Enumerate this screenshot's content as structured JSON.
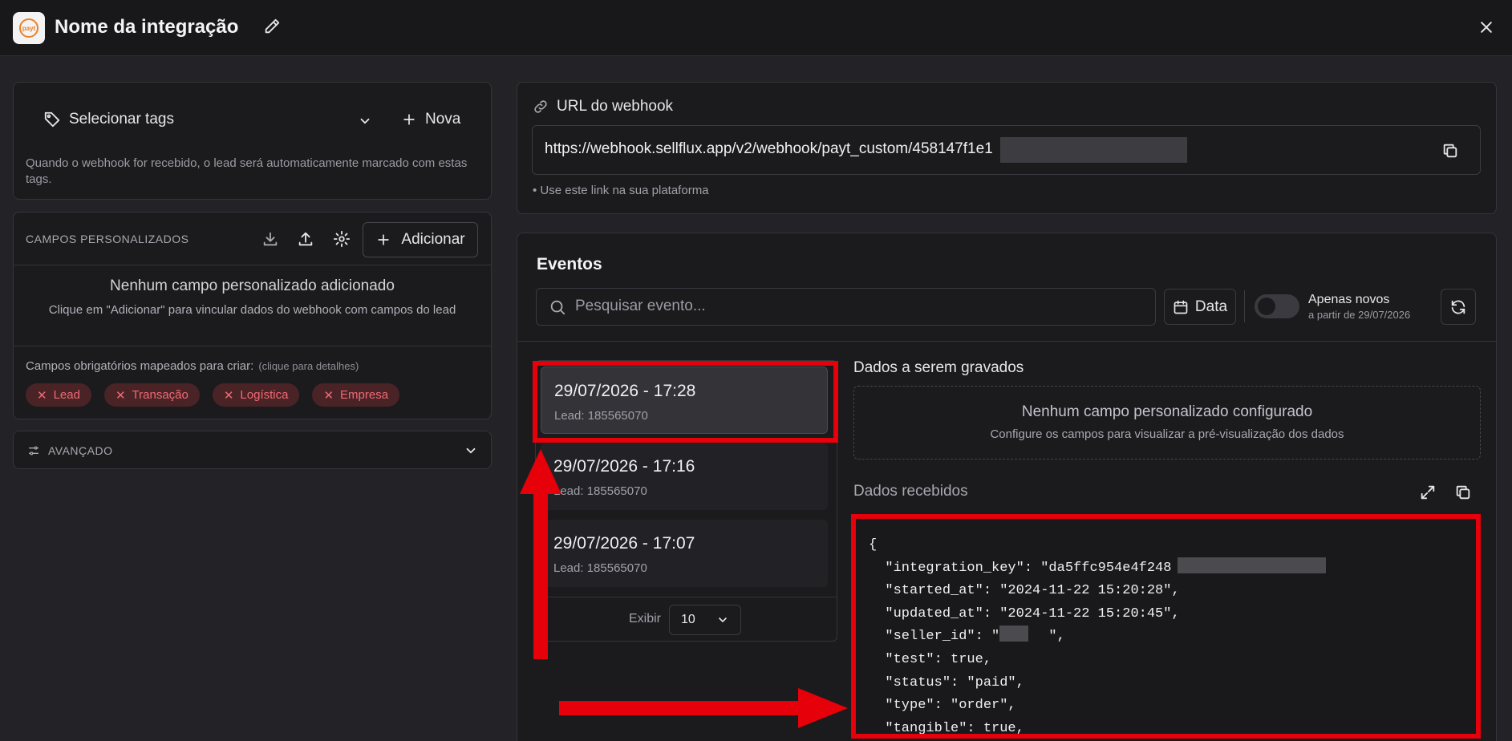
{
  "header": {
    "title": "Nome da integração",
    "logo_text": "payt"
  },
  "tags": {
    "select_label": "Selecionar tags",
    "new_label": "Nova",
    "help": "Quando o webhook for recebido, o lead será automaticamente marcado com estas tags."
  },
  "campos": {
    "title": "CAMPOS PERSONALIZADOS",
    "add_label": "Adicionar",
    "empty_title": "Nenhum campo personalizado adicionado",
    "empty_sub": "Clique em \"Adicionar\" para vincular dados do webhook com campos do lead",
    "required_label": "Campos obrigatórios mapeados para criar:",
    "required_hint": "(clique para detalhes)",
    "chips": [
      "Lead",
      "Transação",
      "Logística",
      "Empresa"
    ]
  },
  "advanced": {
    "label": "AVANÇADO"
  },
  "webhook": {
    "label": "URL do webhook",
    "url": "https://webhook.sellflux.app/v2/webhook/payt_custom/458147f1e1",
    "hint": "• Use este link na sua plataforma"
  },
  "events": {
    "title": "Eventos",
    "search_placeholder": "Pesquisar evento...",
    "date_label": "Data",
    "toggle_title": "Apenas novos",
    "toggle_sub": "a partir de 29/07/2026",
    "toggle_on": false,
    "items": [
      {
        "date": "29/07/2026 - 17:28",
        "lead": "Lead: 185565070"
      },
      {
        "date": "29/07/2026 - 17:16",
        "lead": "Lead: 185565070"
      },
      {
        "date": "29/07/2026 - 17:07",
        "lead": "Lead: 185565070"
      }
    ],
    "show_label": "Exibir",
    "show_value": "10"
  },
  "data_panel": {
    "title": "Dados a serem gravados",
    "empty_title": "Nenhum campo personalizado configurado",
    "empty_sub": "Configure os campos para visualizar a pré-visualização dos dados",
    "received_label": "Dados recebidos",
    "json_lines": [
      "{",
      "  \"integration_key\": \"da5ffc954e4f248                \",",
      "  \"started_at\": \"2024-11-22 15:20:28\",",
      "  \"updated_at\": \"2024-11-22 15:20:45\",",
      "  \"seller_id\": \"R6    \",",
      "  \"test\": true,",
      "  \"status\": \"paid\",",
      "  \"type\": \"order\",",
      "  \"tangible\": true,"
    ]
  },
  "colors": {
    "background": "#232327",
    "card": "#1b1b1e",
    "chip_text": "#f06a73",
    "chip_bg": "#4a2327",
    "annotation_red": "#e5000a"
  }
}
